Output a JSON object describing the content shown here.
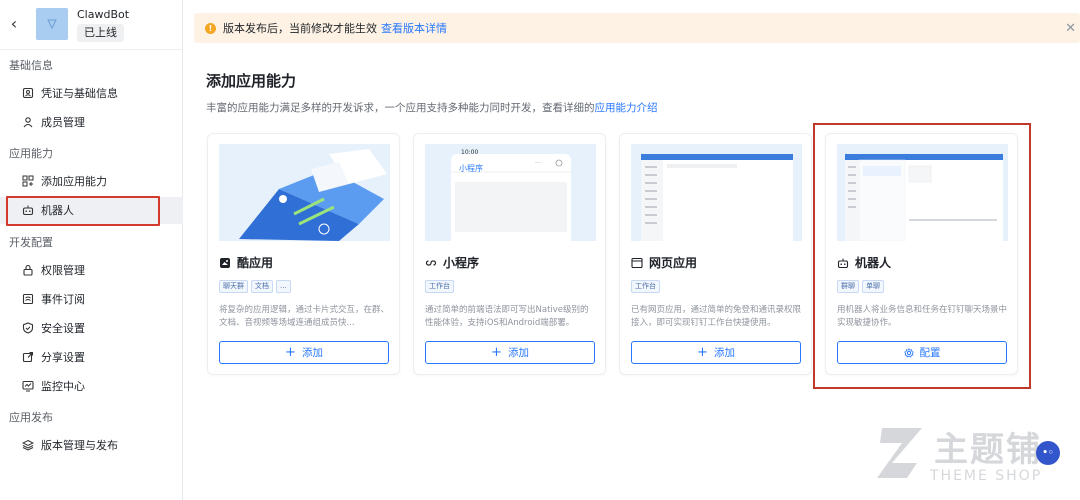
{
  "app": {
    "name": "ClawdBot",
    "status": "已上线"
  },
  "sidebar": {
    "sections": [
      {
        "title": "基础信息",
        "items": [
          {
            "label": "凭证与基础信息",
            "icon": "credential-icon"
          },
          {
            "label": "成员管理",
            "icon": "member-icon"
          }
        ]
      },
      {
        "title": "应用能力",
        "items": [
          {
            "label": "添加应用能力",
            "icon": "grid-add-icon"
          },
          {
            "label": "机器人",
            "icon": "robot-icon",
            "active": true
          }
        ]
      },
      {
        "title": "开发配置",
        "items": [
          {
            "label": "权限管理",
            "icon": "lock-icon"
          },
          {
            "label": "事件订阅",
            "icon": "event-icon"
          },
          {
            "label": "安全设置",
            "icon": "shield-icon"
          },
          {
            "label": "分享设置",
            "icon": "share-icon"
          },
          {
            "label": "监控中心",
            "icon": "monitor-icon"
          }
        ]
      },
      {
        "title": "应用发布",
        "items": [
          {
            "label": "版本管理与发布",
            "icon": "layers-icon"
          }
        ]
      }
    ]
  },
  "notice": {
    "text": "版本发布后，当前修改才能生效",
    "link": "查看版本详情"
  },
  "main": {
    "title": "添加应用能力",
    "description": "丰富的应用能力满足多样的开发诉求，一个应用支持多种能力同时开发，查看详细的",
    "description_link": "应用能力介绍",
    "cards": [
      {
        "title": "酷应用",
        "icon": "cool-app-icon",
        "tags": [
          "聊天群",
          "文档",
          "..."
        ],
        "description": "将复杂的应用逻辑，通过卡片式交互，在群、文档、音视频等场域连通组成员快...",
        "button": "添加",
        "button_icon": "plus-icon"
      },
      {
        "title": "小程序",
        "icon": "mini-program-icon",
        "tags": [
          "工作台"
        ],
        "description": "通过简单的前端语法即可写出Native级别的性能体验，支持iOS和Android端部署。",
        "button": "添加",
        "button_icon": "plus-icon",
        "preview_time": "10:00",
        "preview_title": "小程序"
      },
      {
        "title": "网页应用",
        "icon": "web-app-icon",
        "tags": [
          "工作台"
        ],
        "description": "已有网页应用，通过简单的免登和通讯录权限接入，即可实现钉钉工作台快捷使用。",
        "button": "添加",
        "button_icon": "plus-icon"
      },
      {
        "title": "机器人",
        "icon": "robot-icon",
        "tags": [
          "群聊",
          "单聊"
        ],
        "description": "用机器人将业务信息和任务在钉钉聊天场景中实现敏捷协作。",
        "button": "配置",
        "button_icon": "gear-icon"
      }
    ]
  },
  "watermark": {
    "text": "主题铺",
    "sub": "THEME SHOP"
  },
  "colors": {
    "accent": "#2878ff",
    "highlight": "#d33a2c",
    "notice_bg": "#fdf2e4"
  }
}
